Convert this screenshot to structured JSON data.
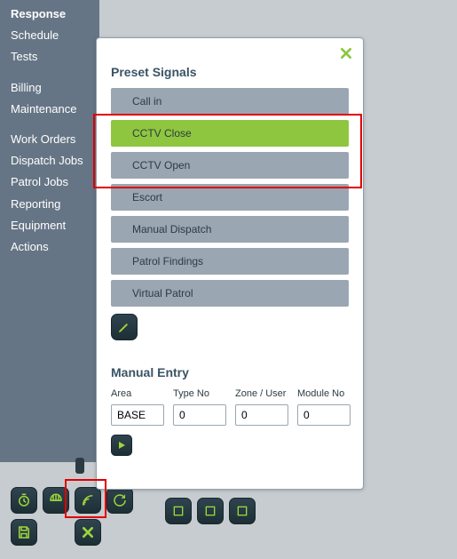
{
  "sidebar": {
    "groups": [
      [
        {
          "label": "Response"
        },
        {
          "label": "Schedule"
        },
        {
          "label": "Tests"
        }
      ],
      [
        {
          "label": "Billing"
        },
        {
          "label": "Maintenance"
        }
      ],
      [
        {
          "label": "Work Orders"
        },
        {
          "label": "Dispatch Jobs"
        },
        {
          "label": "Patrol Jobs"
        },
        {
          "label": "Reporting"
        },
        {
          "label": "Equipment"
        },
        {
          "label": "Actions"
        }
      ]
    ]
  },
  "modal": {
    "preset_title": "Preset Signals",
    "signals": [
      {
        "label": "Call in",
        "selected": false
      },
      {
        "label": "CCTV Close",
        "selected": true
      },
      {
        "label": "CCTV Open",
        "selected": false
      },
      {
        "label": "Escort",
        "selected": false
      },
      {
        "label": "Manual Dispatch",
        "selected": false
      },
      {
        "label": "Patrol Findings",
        "selected": false
      },
      {
        "label": "Virtual Patrol",
        "selected": false
      }
    ],
    "manual_title": "Manual Entry",
    "cols": {
      "area": {
        "label": "Area",
        "value": "BASE"
      },
      "type_no": {
        "label": "Type No",
        "value": "0"
      },
      "zone": {
        "label": "Zone / User",
        "value": "0"
      },
      "module": {
        "label": "Module No",
        "value": "0"
      }
    }
  }
}
